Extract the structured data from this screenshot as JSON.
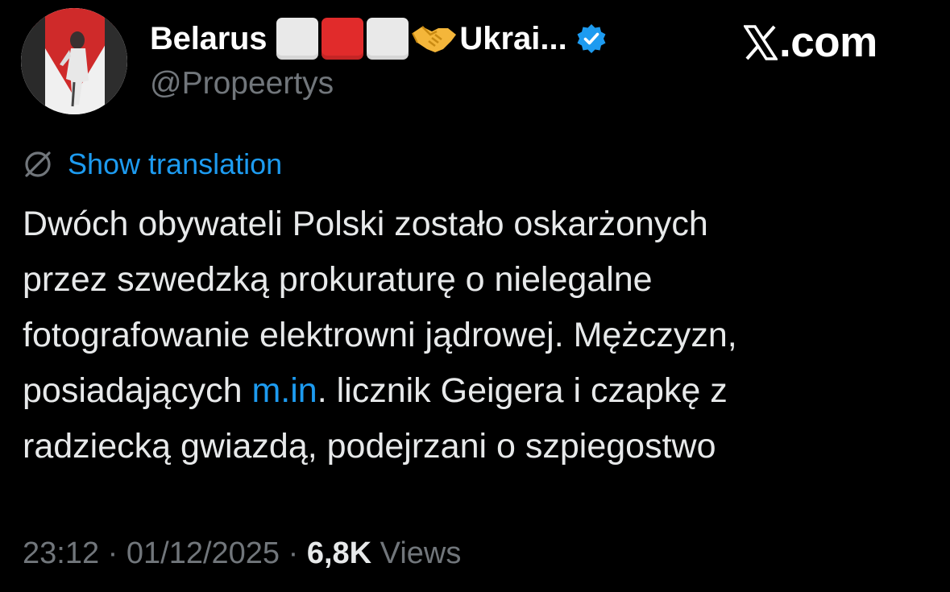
{
  "author": {
    "display_name": "Belarus",
    "name_suffix": "Ukrai...",
    "handle": "@Propeertys",
    "verified": true,
    "flag_colors": [
      "#e9e9e9",
      "#e12b2b",
      "#e9e9e9"
    ],
    "emoji": "handshake-icon"
  },
  "brand": {
    "text": ".com",
    "logo": "x-logo-icon"
  },
  "translation": {
    "label": "Show translation",
    "icon": "globe-icon"
  },
  "tweet": {
    "line1": "Dwóch obywateli Polski zostało oskarżonych",
    "line2": "przez szwedzką prokuraturę o nielegalne",
    "line3": "fotografowanie elektrowni jądrowej. Mężczyzn,",
    "line4_prefix": "posiadających ",
    "line4_link": "m.in",
    "line4_suffix": ". licznik Geigera i czapkę z",
    "line5": "radziecką gwiazdą, podejrzani o szpiegostwo"
  },
  "meta": {
    "time": "23:12",
    "separator": " · ",
    "date": "01/12/2025",
    "views_count": "6,8K",
    "views_label": " Views"
  },
  "colors": {
    "background": "#000000",
    "text": "#e7e9ea",
    "muted": "#71767b",
    "accent": "#1d9bf0"
  }
}
